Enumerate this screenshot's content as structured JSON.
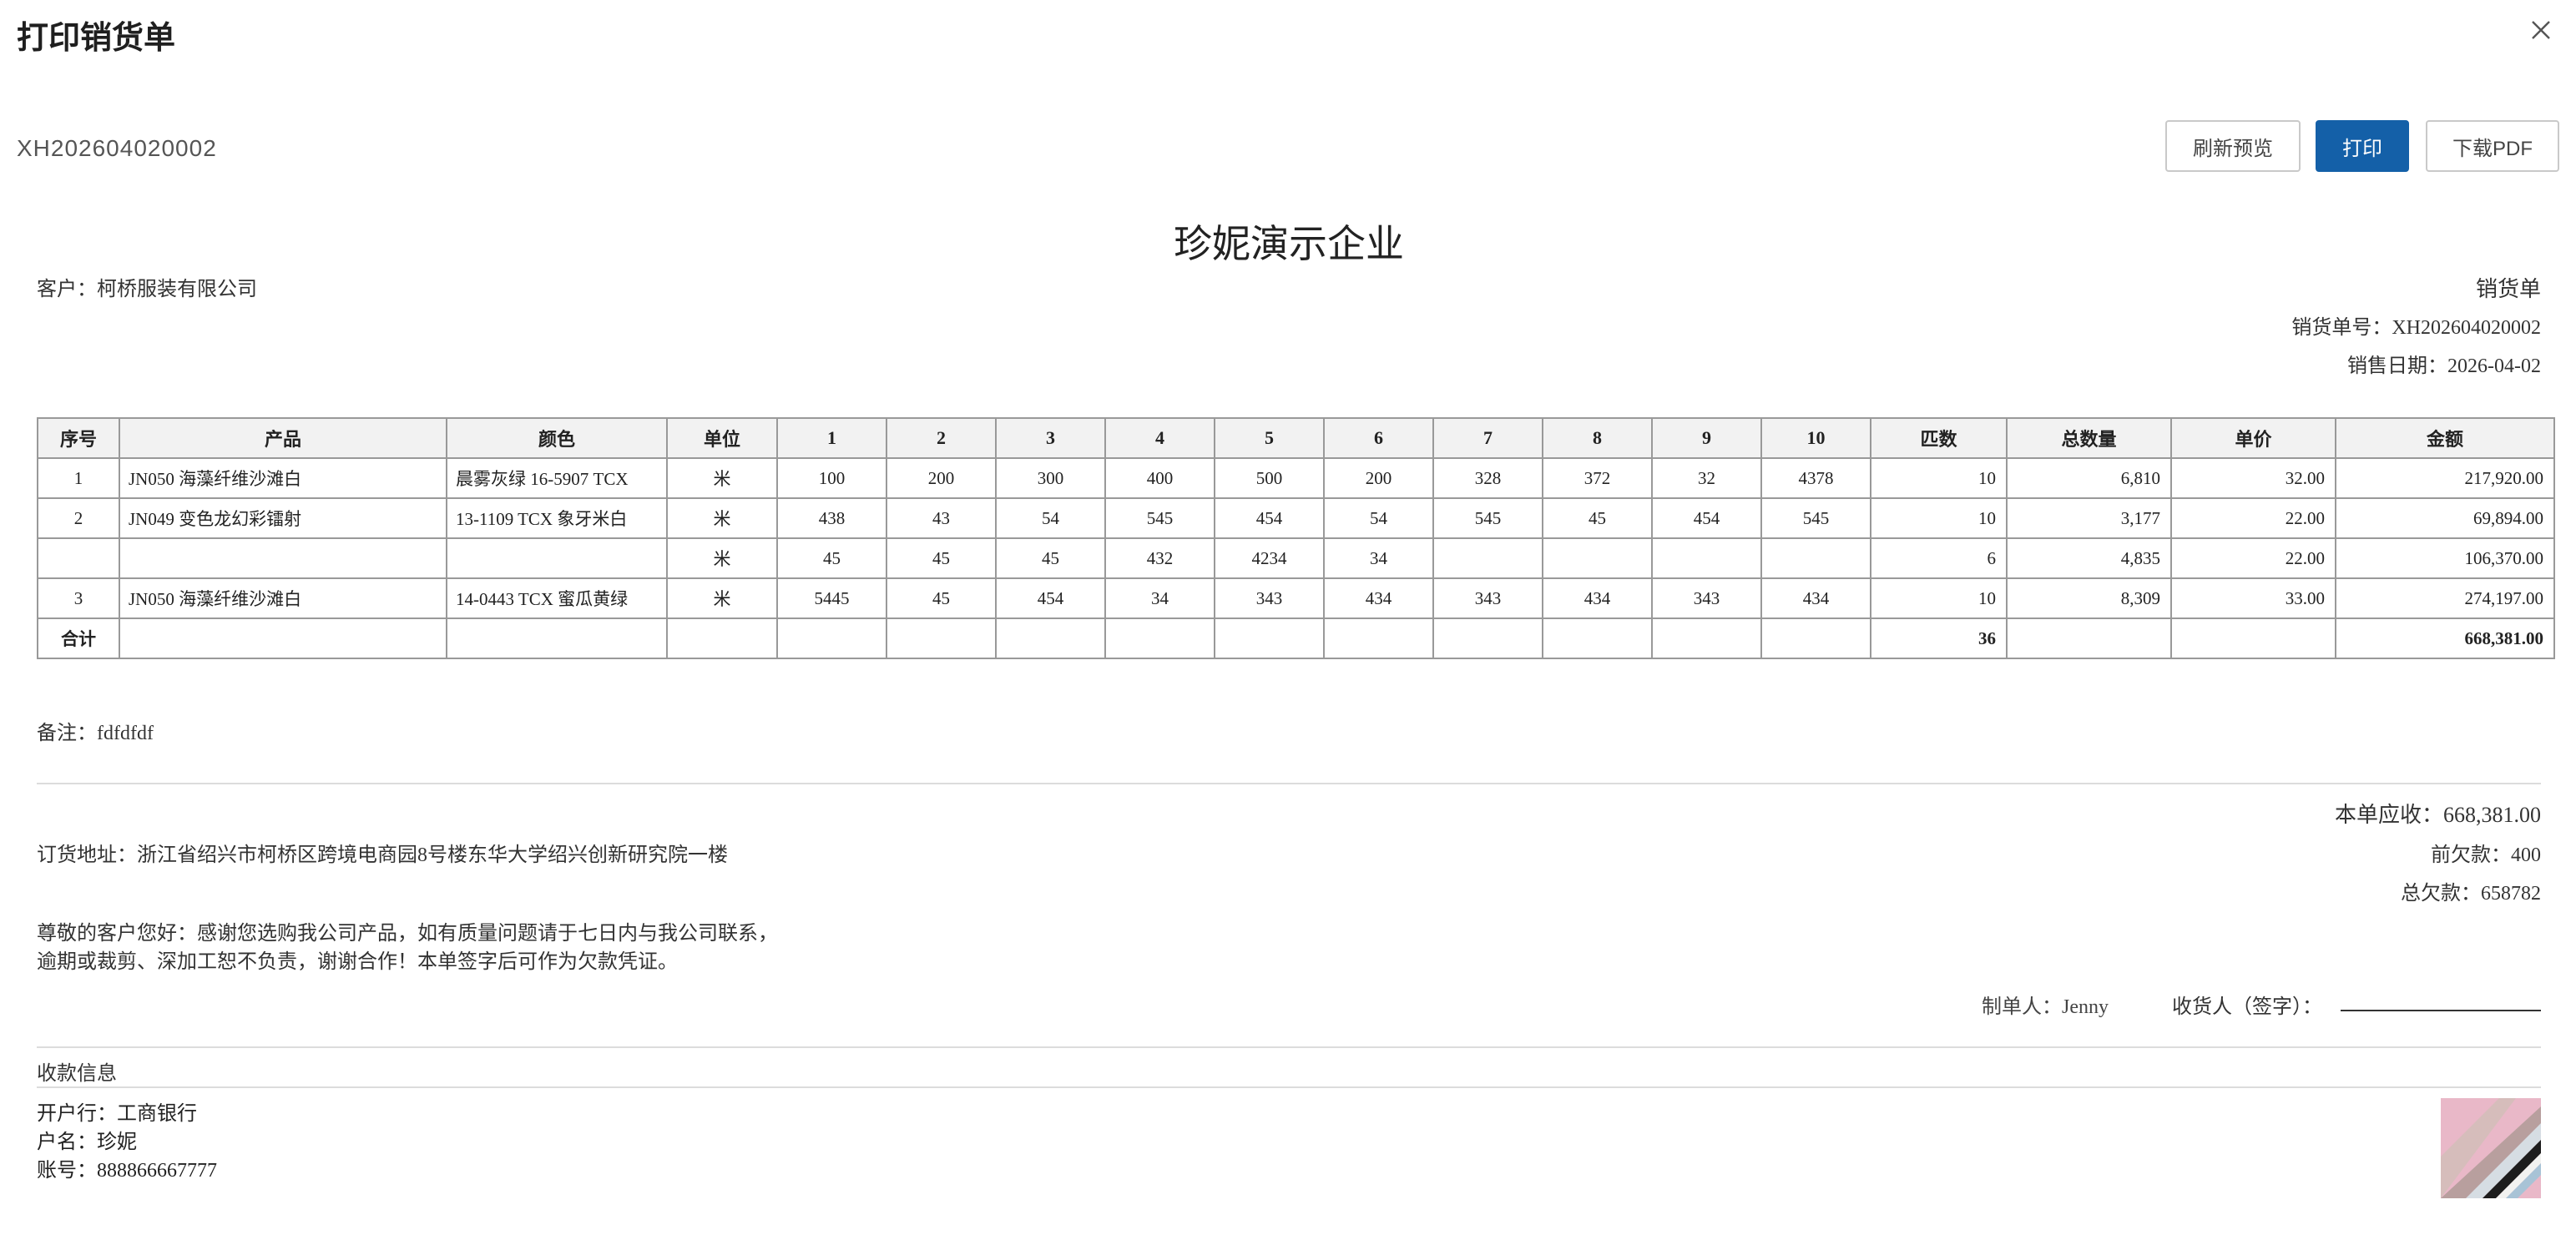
{
  "dialog": {
    "title": "打印销货单",
    "order_no": "XH202604020002",
    "buttons": {
      "refresh": "刷新预览",
      "print": "打印",
      "pdf": "下载PDF"
    },
    "close_icon": "close-icon",
    "accent_color": "#1460a8"
  },
  "doc": {
    "company": "珍妮演示企业",
    "customer": "客户：柯桥服装有限公司",
    "doc_type": "销货单",
    "doc_no": "销货单号：XH202604020002",
    "doc_date": "销售日期：2026-04-02",
    "table": {
      "headers": [
        "序号",
        "产品",
        "颜色",
        "单位",
        "1",
        "2",
        "3",
        "4",
        "5",
        "6",
        "7",
        "8",
        "9",
        "10",
        "匹数",
        "总数量",
        "单价",
        "金额"
      ],
      "rows": [
        [
          "1",
          "JN050 海藻纤维沙滩白",
          "晨雾灰绿 16-5907 TCX",
          "米",
          "100",
          "200",
          "300",
          "400",
          "500",
          "200",
          "328",
          "372",
          "32",
          "4378",
          "10",
          "6,810",
          "32.00",
          "217,920.00"
        ],
        [
          "2",
          "JN049 变色龙幻彩镭射",
          "13-1109 TCX 象牙米白",
          "米",
          "438",
          "43",
          "54",
          "545",
          "454",
          "54",
          "545",
          "45",
          "454",
          "545",
          "10",
          "3,177",
          "22.00",
          "69,894.00"
        ],
        [
          "",
          "",
          "",
          "米",
          "45",
          "45",
          "45",
          "432",
          "4234",
          "34",
          "",
          "",
          "",
          "",
          "6",
          "4,835",
          "22.00",
          "106,370.00"
        ],
        [
          "3",
          "JN050 海藻纤维沙滩白",
          "14-0443 TCX 蜜瓜黄绿",
          "米",
          "5445",
          "45",
          "454",
          "34",
          "343",
          "434",
          "343",
          "434",
          "343",
          "434",
          "10",
          "8,309",
          "33.00",
          "274,197.00"
        ]
      ],
      "total": [
        "合计",
        "",
        "",
        "",
        "",
        "",
        "",
        "",
        "",
        "",
        "",
        "",
        "",
        "",
        "36",
        "",
        "",
        "668,381.00"
      ]
    },
    "remark": "备注：fdfdfdf",
    "address": "订货地址：浙江省绍兴市柯桥区跨境电商园8号楼东华大学绍兴创新研究院一楼",
    "receivable": "本单应收：668,381.00",
    "prev_debt": "前欠款：400",
    "total_debt": "总欠款：658782",
    "notice": [
      "尊敬的客户您好：感谢您选购我公司产品，如有质量问题请于七日内与我公司联系，",
      "逾期或裁剪、深加工恕不负责，谢谢合作！本单签字后可作为欠款凭证。"
    ],
    "maker": "制单人：Jenny",
    "receiver": "收货人（签字）：",
    "payment": {
      "title": "收款信息",
      "bank": "开户行：工商银行",
      "name": "户名：珍妮",
      "account": "账号：888866667777"
    },
    "qr_image": "fabric-qr-image"
  }
}
